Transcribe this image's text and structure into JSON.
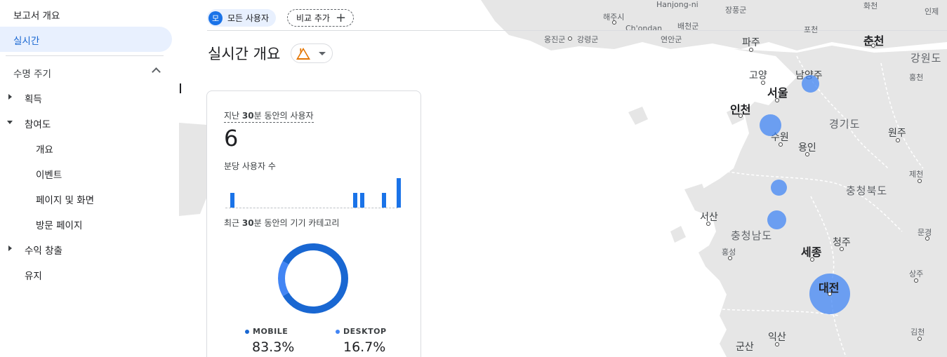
{
  "sidebar": {
    "report_overview": "보고서 개요",
    "realtime": "실시간",
    "lifecycle_header": "수명 주기",
    "acquisition": "획득",
    "engagement": "참여도",
    "engagement_children": [
      "개요",
      "이벤트",
      "페이지 및 화면",
      "방문 페이지"
    ],
    "monetization": "수익 창출",
    "retention": "유지"
  },
  "header": {
    "avatar_letter": "모",
    "all_users_chip": "모든 사용자",
    "compare_chip": "비교 추가",
    "page_title": "실시간 개요",
    "warning_icon": "warning-triangle-icon"
  },
  "card": {
    "users_label_pre": "지난 ",
    "users_label_bold": "30",
    "users_label_post": "분 동안의 사용자",
    "users_value": "6",
    "per_minute_label": "분당 사용자 수",
    "per_minute_values": [
      2,
      0,
      0,
      0,
      0,
      0,
      0,
      0,
      0,
      0,
      0,
      0,
      0,
      0,
      0,
      0,
      0,
      2,
      2,
      0,
      0,
      2,
      0,
      4
    ],
    "device_label_pre": "최근 ",
    "device_label_bold": "30",
    "device_label_post": "분 동안의 기기 카테고리",
    "colors": {
      "mobile": "#1967d2",
      "desktop": "#4285f4"
    }
  },
  "chart_data": {
    "type": "pie",
    "categories": [
      "MOBILE",
      "DESKTOP"
    ],
    "values": [
      83.3,
      16.7
    ],
    "value_labels": [
      "83.3%",
      "16.7%"
    ]
  },
  "map": {
    "cities": {
      "seoul": "서울",
      "incheon": "인천",
      "suwon": "수원",
      "yongin": "용인",
      "goyang": "고양",
      "namyangju": "남양주",
      "paju": "파주",
      "chuncheon": "춘천",
      "wonju": "원주",
      "seosan": "서산",
      "sejong": "세종",
      "cheongju": "청주",
      "daejeon": "대전",
      "iksan": "익산",
      "gunsan": "군산",
      "pocheon": "포천",
      "yeoncheon": "연천군",
      "jangpung": "장풍군",
      "ongjin": "옹진군",
      "gangnyeong": "강령군",
      "haeju": "해주시",
      "chondan": "Ch'ondan",
      "baecheon": "배천군",
      "yonan": "연안군",
      "hanjong": "Hanjong-ni",
      "hongcheon": "홍천",
      "jecheon": "제천",
      "mungyeong": "문경",
      "sangju": "상주",
      "gimcheon": "김천",
      "hongseong": "홍성",
      "inje": "인제",
      "hwachon": "화천"
    },
    "provinces": {
      "gangwon": "강원도",
      "gyeonggi": "경기도",
      "chungbuk": "충청북도",
      "chungnam": "충청남도"
    }
  }
}
